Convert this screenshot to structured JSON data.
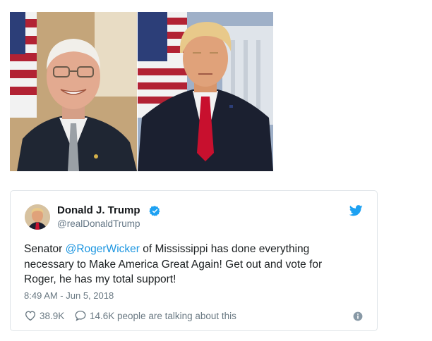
{
  "photos": [
    {
      "subject": "Roger Wicker"
    },
    {
      "subject": "Donald J. Trump"
    }
  ],
  "tweet": {
    "author_name": "Donald J. Trump",
    "handle": "@realDonaldTrump",
    "verified": true,
    "text_before_mention": "Senator ",
    "mention": "@RogerWicker",
    "text_after_mention": " of Mississippi has done everything necessary to Make America Great Again! Get out and vote for Roger, he has my total support!",
    "timestamp": "8:49 AM - Jun 5, 2018",
    "likes": "38.9K",
    "replies_text": "14.6K people are talking about this"
  },
  "icons": {
    "verified": "verified-badge-icon",
    "brand": "twitter-bird-icon",
    "like": "heart-icon",
    "reply": "speech-bubble-icon",
    "info": "info-icon"
  },
  "colors": {
    "accent": "#1da1f2",
    "mention": "#1b95e0",
    "muted": "#697882",
    "border": "#dfe4e8"
  }
}
